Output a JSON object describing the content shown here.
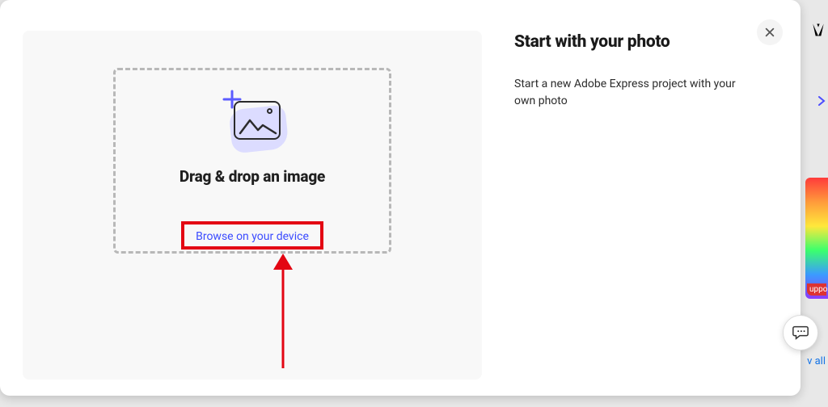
{
  "right": {
    "title": "Start with your photo",
    "desc": "Start a new Adobe Express project with your own photo"
  },
  "dropzone": {
    "title": "Drag & drop an image",
    "browse": "Browse on your device"
  },
  "bg": {
    "card_label": "uppo",
    "view_all": "v all"
  },
  "icons": {
    "close": "close-icon",
    "chat": "chat-icon",
    "image_add": "image-add-icon",
    "adobe_logo": "adobe-logo-icon",
    "chevron_right": "chevron-right-icon"
  }
}
